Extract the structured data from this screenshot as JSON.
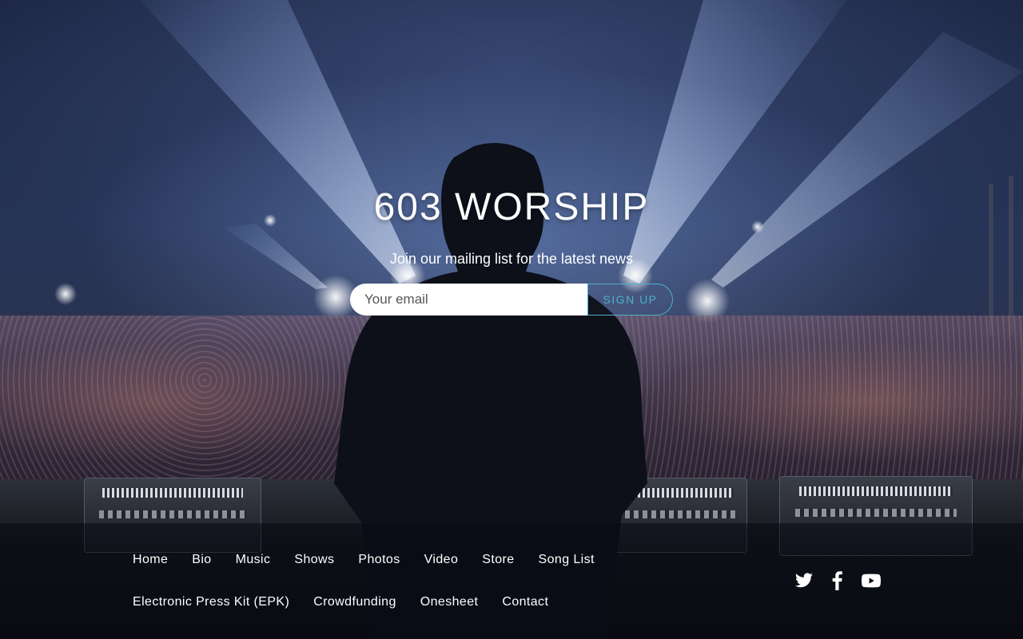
{
  "hero": {
    "title": "603 WORSHIP",
    "subtitle": "Join our mailing list for the latest news",
    "email_placeholder": "Your email",
    "signup_label": "SIGN UP"
  },
  "nav": {
    "row1": [
      "Home",
      "Bio",
      "Music",
      "Shows",
      "Photos",
      "Video",
      "Store",
      "Song List"
    ],
    "row2": [
      "Electronic Press Kit (EPK)",
      "Crowdfunding",
      "Onesheet",
      "Contact"
    ]
  },
  "social": [
    "twitter-icon",
    "facebook-icon",
    "youtube-icon"
  ],
  "colors": {
    "accent": "#4fb1c9",
    "text": "#ffffff",
    "field_bg": "#ffffff"
  }
}
